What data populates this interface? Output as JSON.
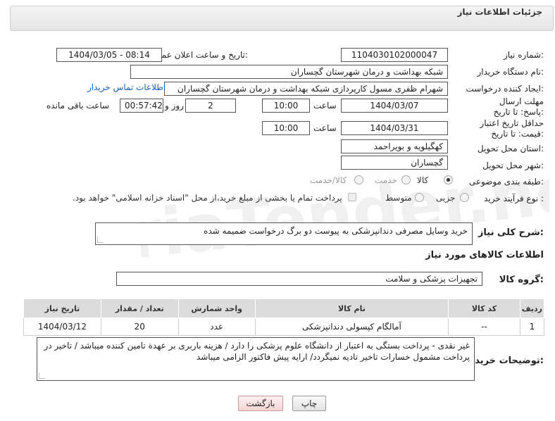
{
  "header": {
    "title": "جزئیات اطلاعات نیاز"
  },
  "fields": {
    "need_number": {
      "label": "شماره نیاز:",
      "value": "1104030102000047"
    },
    "announce_datetime": {
      "label": "تاریخ و ساعت اعلان عمومی:",
      "value": "1404/03/05 - 08:14"
    },
    "buyer_org": {
      "label": "نام دستگاه خریدار:",
      "value": "شبکه بهداشت و درمان شهرستان گچساران"
    },
    "requester": {
      "label": "ایجاد کننده درخواست:",
      "value": "شهرام ظفری مسول کارپردازی  شبکه بهداشت و درمان شهرستان گچساران",
      "link": "اطلاعات تماس خریدار"
    },
    "reply_deadline": {
      "label": "مهلت ارسال پاسخ: تا تاریخ:",
      "date": "1404/03/07",
      "time_label": "ساعت",
      "time": "10:00",
      "days": "2",
      "days_label": "روز و",
      "remaining": "00:57:42",
      "remaining_label": "ساعت باقی مانده"
    },
    "price_validity": {
      "label": "حداقل تاریخ اعتبار قیمت: تا تاریخ:",
      "date": "1404/03/31",
      "time_label": "ساعت",
      "time": "10:00"
    },
    "delivery_province": {
      "label": "استان محل تحویل:",
      "value": "کهگیلویه و بویراحمد"
    },
    "delivery_city": {
      "label": "شهر محل تحویل:",
      "value": "گچساران"
    },
    "category": {
      "label": "طبقه بندی موضوعی:",
      "options": [
        "کالا",
        "خدمت",
        "کالا/خدمت"
      ],
      "selected": "کالا"
    },
    "process_type": {
      "label": "نوع فرآیند خرید :",
      "options": [
        "جزیی",
        "متوسط"
      ],
      "selected": "",
      "note": "پرداخت تمام یا بخشی از مبلغ خرید،از محل \"اسناد خزانه اسلامی\" خواهد بود."
    }
  },
  "description": {
    "label": "شرح کلی نیاز:",
    "value": "خرید وسایل مصرفی دندانپزشکی به پیوست دو برگ درخواست ضمیمه شده"
  },
  "goods_section": {
    "title": "اطلاعات کالاهای مورد نیاز"
  },
  "goods_group": {
    "label": "گروه کالا:",
    "value": "تجهیزات پزشکی و سلامت"
  },
  "table": {
    "headers": [
      "ردیف",
      "کد کالا",
      "نام کالا",
      "واحد شمارش",
      "تعداد / مقدار",
      "تاریخ نیاز"
    ],
    "rows": [
      [
        "1",
        "--",
        "آمالگام کپسولی دندانپزشکی",
        "عدد",
        "20",
        "1404/03/12"
      ]
    ]
  },
  "buyer_notes": {
    "label": "توضیحات خریدار:",
    "value": "غیر نقدی - پرداخت بستگی به اعتبار از دانشگاه علوم پزشکی را دارد         / هزینه باربری بر عهدة تامین کننده میباشد / تاخیر در پرداخت مشمول خسارات تاخیر تادیه نمیگردد/ ارایه پیش فاکتور الزامی میباشد"
  },
  "buttons": {
    "print": "چاپ",
    "back": "بازگشت"
  },
  "colors": {
    "link": "#1a5fb4",
    "header_bg": "#e6e6e6",
    "table_header_bg": "#dcdcdc",
    "back_button_bg": "#f5d5d5"
  },
  "watermark": {
    "text": "AriaTender.net"
  }
}
